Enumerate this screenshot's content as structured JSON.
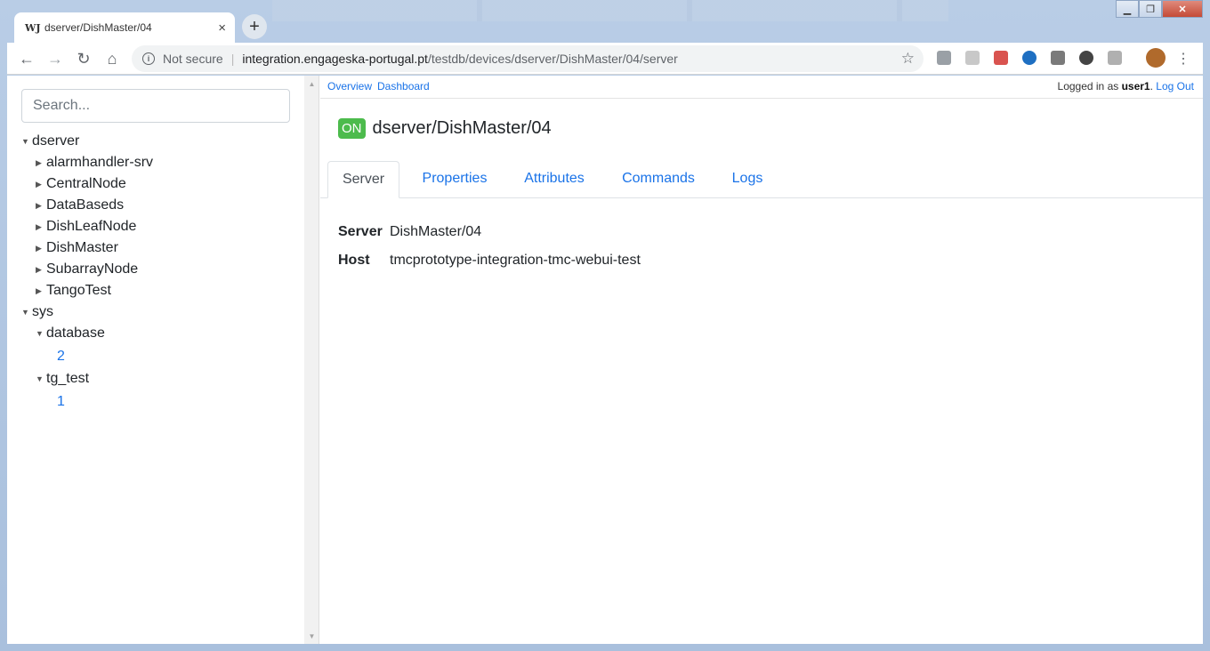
{
  "browser": {
    "tab_favicon": "WJ",
    "tab_title": "dserver/DishMaster/04",
    "tab_close": "×",
    "new_tab": "+",
    "security_label": "Not secure",
    "url_host": "integration.engageska-portugal.pt",
    "url_path": "/testdb/devices/dserver/DishMaster/04/server",
    "icons": [
      "back-icon",
      "forward-icon",
      "reload-icon",
      "home-icon",
      "info-icon",
      "star-icon",
      "menu-icon"
    ]
  },
  "sidebar": {
    "search_placeholder": "Search...",
    "tree": [
      {
        "label": "dserver",
        "level": 0,
        "expanded": true
      },
      {
        "label": "alarmhandler-srv",
        "level": 1,
        "expanded": false
      },
      {
        "label": "CentralNode",
        "level": 1,
        "expanded": false
      },
      {
        "label": "DataBaseds",
        "level": 1,
        "expanded": false
      },
      {
        "label": "DishLeafNode",
        "level": 1,
        "expanded": false
      },
      {
        "label": "DishMaster",
        "level": 1,
        "expanded": false
      },
      {
        "label": "SubarrayNode",
        "level": 1,
        "expanded": false
      },
      {
        "label": "TangoTest",
        "level": 1,
        "expanded": false
      },
      {
        "label": "sys",
        "level": 0,
        "expanded": true
      },
      {
        "label": "database",
        "level": 1,
        "expanded": true
      },
      {
        "label": "2",
        "level": 2,
        "link": true
      },
      {
        "label": "tg_test",
        "level": 1,
        "expanded": true
      },
      {
        "label": "1",
        "level": 2,
        "link": true
      }
    ]
  },
  "topbar": {
    "overview": "Overview",
    "dashboard": "Dashboard",
    "logged_in_prefix": "Logged in as ",
    "username": "user1",
    "period": ".",
    "logout": "Log Out"
  },
  "device": {
    "state": "ON",
    "state_color": "#4cbb4c",
    "name": "dserver/DishMaster/04"
  },
  "tabs": [
    "Server",
    "Properties",
    "Attributes",
    "Commands",
    "Logs"
  ],
  "active_tab": "Server",
  "server_info": [
    {
      "key": "Server",
      "value": "DishMaster/04"
    },
    {
      "key": "Host",
      "value": "tmcprototype-integration-tmc-webui-test"
    }
  ],
  "colors": {
    "link": "#1a73e8",
    "on_badge": "#4cbb4c"
  }
}
